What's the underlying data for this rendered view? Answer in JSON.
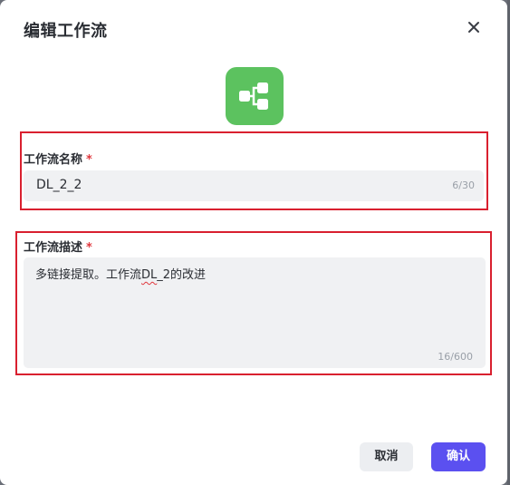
{
  "dialog": {
    "title": "编辑工作流",
    "close_icon": "close-icon",
    "app_icon": "workflow-icon",
    "app_icon_color": "#5cc25f"
  },
  "name_field": {
    "label": "工作流名称",
    "required_mark": "*",
    "value": "DL_2_2",
    "counter": "6/30"
  },
  "desc_field": {
    "label": "工作流描述",
    "required_mark": "*",
    "value_prefix": "多链接提取。工作流",
    "value_flagged": "DL",
    "value_suffix": "_2的改进",
    "counter": "16/600"
  },
  "footer": {
    "cancel_label": "取消",
    "confirm_label": "确认",
    "confirm_color": "#5b50f0"
  },
  "highlight_color": "#d9202f"
}
